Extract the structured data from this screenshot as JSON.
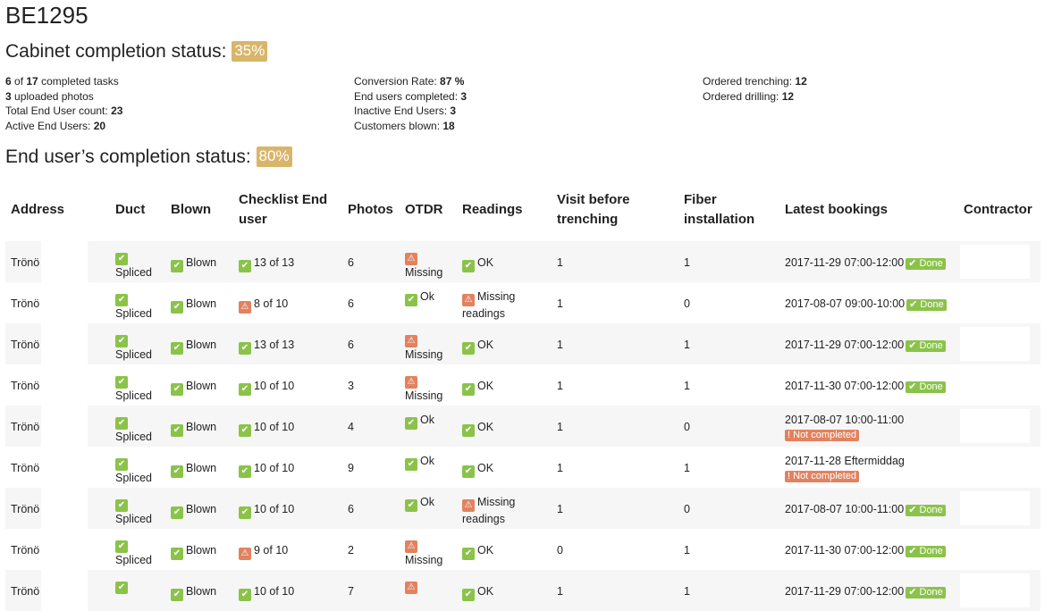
{
  "site_id": "BE1295",
  "cabinet": {
    "heading": "Cabinet completion status:",
    "percent": "35%",
    "stats_col1": [
      {
        "value": "6",
        "text": " of "
      },
      {
        "value": "3",
        "text": " uploaded photos"
      },
      {
        "label": "Total End User count: ",
        "value": "23"
      },
      {
        "label": "Active End Users: ",
        "value": "20"
      }
    ],
    "completed_total": "17",
    "completed_suffix": " completed tasks",
    "stats_col2": [
      {
        "label": "Conversion Rate: ",
        "value": "87 %"
      },
      {
        "label": "End users completed: ",
        "value": "3"
      },
      {
        "label": "Inactive End Users: ",
        "value": "3"
      },
      {
        "label": "Customers blown: ",
        "value": "18"
      }
    ],
    "stats_col3": [
      {
        "label": "Ordered trenching: ",
        "value": "12"
      },
      {
        "label": "Ordered drilling: ",
        "value": "12"
      }
    ]
  },
  "end_user": {
    "heading": "End user’s completion status:",
    "percent": "80%"
  },
  "columns": [
    "Address",
    "Duct",
    "Blown",
    "Checklist End user",
    "Photos",
    "OTDR",
    "Readings",
    "Visit before trenching",
    "Fiber installation",
    "Latest bookings",
    "Contractor"
  ],
  "rows": [
    {
      "address": "Trönö",
      "duct": "Spliced",
      "blown": "Blown",
      "checklist": "13 of 13",
      "checklist_ok": true,
      "photos": "6",
      "otdr": "Missing",
      "otdr_ok": false,
      "readings": "OK",
      "readings_ok": true,
      "visit": "1",
      "fiber": "1",
      "booking": "2017-11-29 07:00-12:00",
      "status": "Done",
      "done": true
    },
    {
      "address": "Trönö",
      "duct": "Spliced",
      "blown": "Blown",
      "checklist": "8 of 10",
      "checklist_ok": false,
      "photos": "6",
      "otdr": "Ok",
      "otdr_ok": true,
      "readings": "Missing readings",
      "readings_ok": false,
      "visit": "1",
      "fiber": "0",
      "booking": "2017-08-07 09:00-10:00",
      "status": "Done",
      "done": true
    },
    {
      "address": "Trönö",
      "duct": "Spliced",
      "blown": "Blown",
      "checklist": "13 of 13",
      "checklist_ok": true,
      "photos": "6",
      "otdr": "Missing",
      "otdr_ok": false,
      "readings": "OK",
      "readings_ok": true,
      "visit": "1",
      "fiber": "1",
      "booking": "2017-11-29 07:00-12:00",
      "status": "Done",
      "done": true
    },
    {
      "address": "Trönö",
      "duct": "Spliced",
      "blown": "Blown",
      "checklist": "10 of 10",
      "checklist_ok": true,
      "photos": "3",
      "otdr": "Missing",
      "otdr_ok": false,
      "readings": "OK",
      "readings_ok": true,
      "visit": "1",
      "fiber": "1",
      "booking": "2017-11-30 07:00-12:00",
      "status": "Done",
      "done": true
    },
    {
      "address": "Trönö",
      "duct": "Spliced",
      "blown": "Blown",
      "checklist": "10 of 10",
      "checklist_ok": true,
      "photos": "4",
      "otdr": "Ok",
      "otdr_ok": true,
      "readings": "OK",
      "readings_ok": true,
      "visit": "1",
      "fiber": "0",
      "booking": "2017-08-07 10:00-11:00",
      "status": "Not completed",
      "done": false
    },
    {
      "address": "Trönö",
      "duct": "Spliced",
      "blown": "Blown",
      "checklist": "10 of 10",
      "checklist_ok": true,
      "photos": "9",
      "otdr": "Ok",
      "otdr_ok": true,
      "readings": "OK",
      "readings_ok": true,
      "visit": "1",
      "fiber": "1",
      "booking": "2017-11-28 Eftermiddag",
      "status": "Not completed",
      "done": false
    },
    {
      "address": "Trönö",
      "duct": "Spliced",
      "blown": "Blown",
      "checklist": "10 of 10",
      "checklist_ok": true,
      "photos": "6",
      "otdr": "Ok",
      "otdr_ok": true,
      "readings": "Missing readings",
      "readings_ok": false,
      "visit": "1",
      "fiber": "0",
      "booking": "2017-08-07 10:00-11:00",
      "status": "Done",
      "done": true
    },
    {
      "address": "Trönö",
      "duct": "Spliced",
      "blown": "Blown",
      "checklist": "9 of 10",
      "checklist_ok": false,
      "photos": "2",
      "otdr": "Missing",
      "otdr_ok": false,
      "readings": "OK",
      "readings_ok": true,
      "visit": "0",
      "fiber": "1",
      "booking": "2017-11-30 07:00-12:00",
      "status": "Done",
      "done": true
    },
    {
      "address": "Trönö",
      "duct": "",
      "blown": "Blown",
      "checklist": "10 of 10",
      "checklist_ok": true,
      "photos": "7",
      "otdr": "",
      "otdr_ok": false,
      "readings": "OK",
      "readings_ok": true,
      "visit": "1",
      "fiber": "1",
      "booking": "2017-11-29 07:00-12:00",
      "status": "Done",
      "done": true
    }
  ],
  "colors": {
    "ok": "#8bc34a",
    "warning": "#e2825f",
    "badge": "#d9b56a"
  }
}
